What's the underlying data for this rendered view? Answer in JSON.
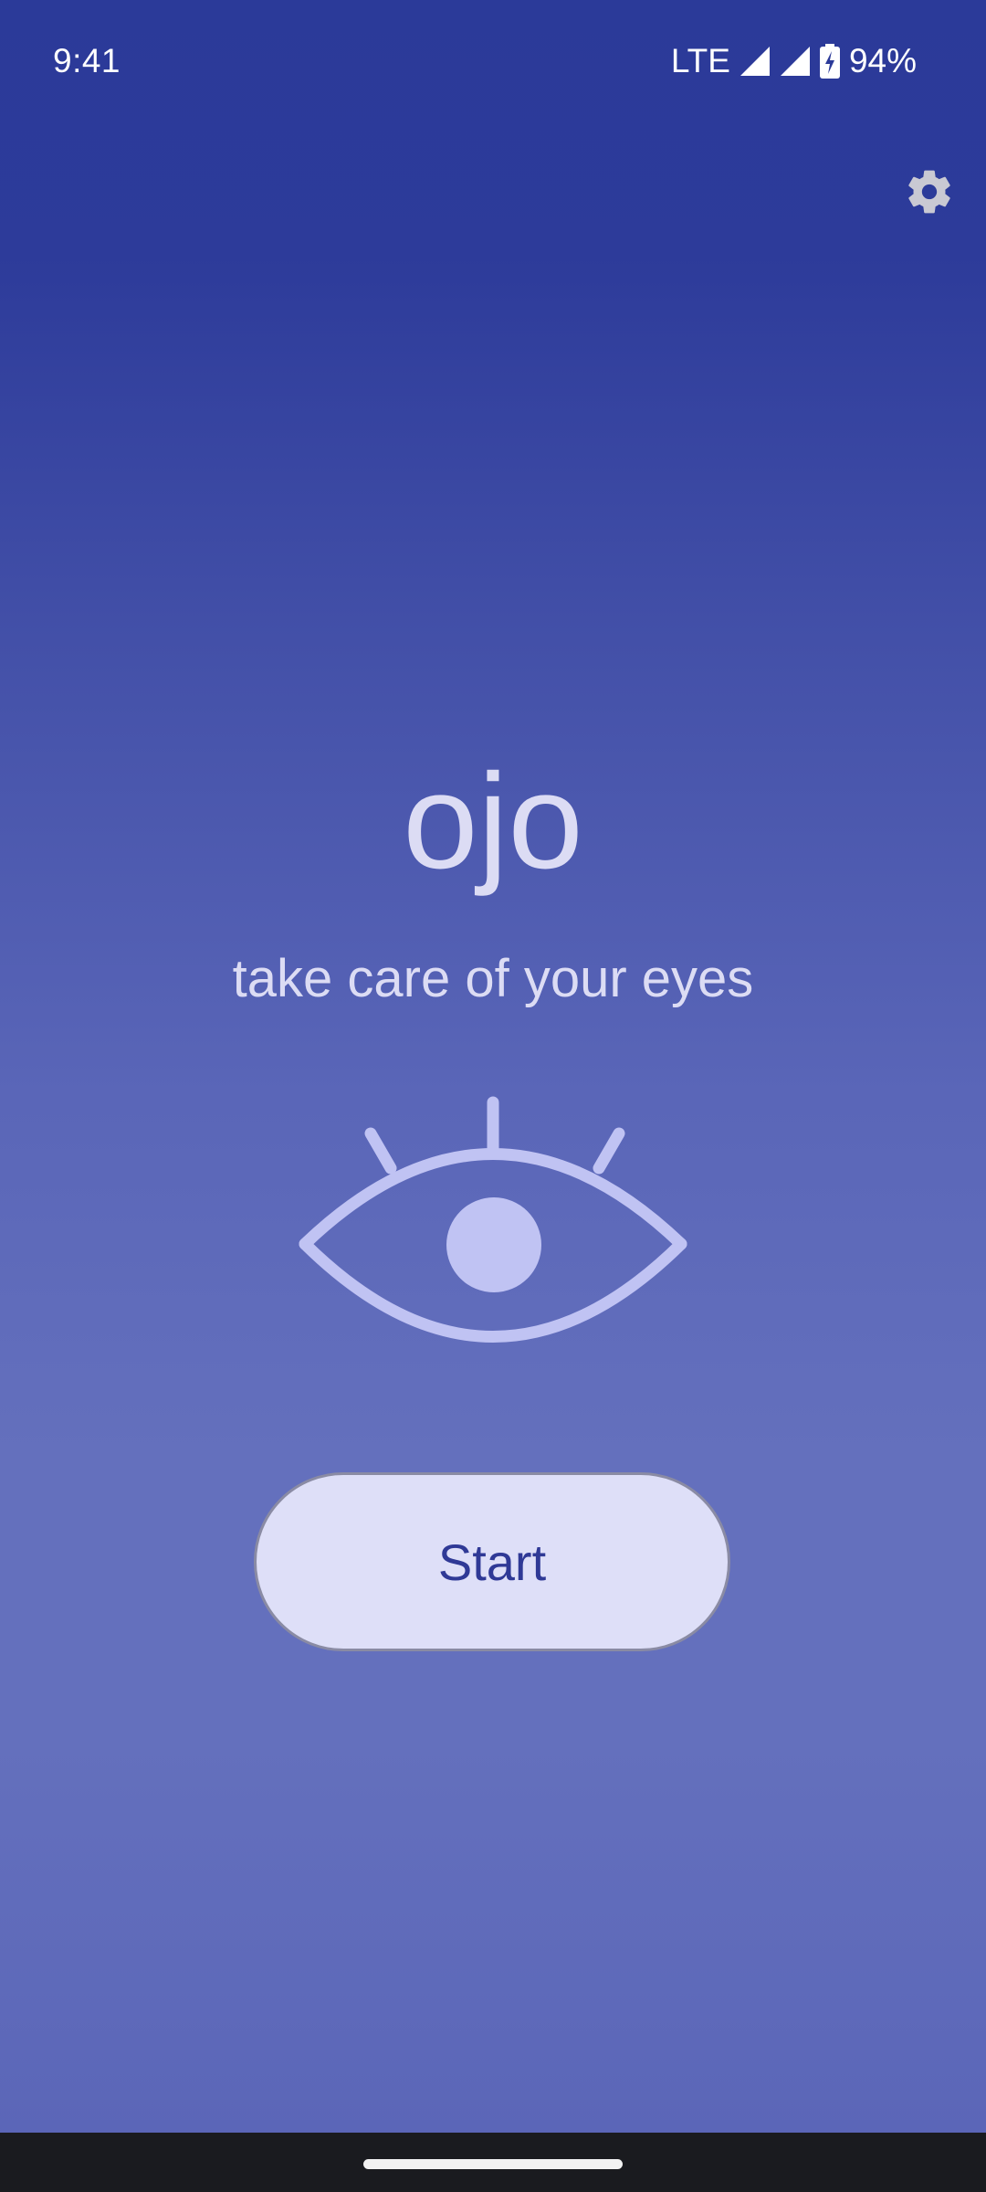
{
  "status_bar": {
    "time": "9:41",
    "network": "LTE",
    "battery": "94%",
    "icons": [
      "signal-icon",
      "signal-icon",
      "battery-charging-icon"
    ]
  },
  "header": {
    "settings_icon": "gear-icon"
  },
  "main": {
    "title": "ojo",
    "tagline": "take care of your eyes",
    "illustration_icon": "eye-icon",
    "start_label": "Start"
  },
  "colors": {
    "background_top": "#2b3a99",
    "background_mid": "#6470bd",
    "text": "#dcdcf4",
    "eye": "#c0c3f3",
    "button_fill": "#dedff8",
    "button_text": "#2f3996",
    "gear": "#c9c9d3",
    "nav_bar": "#1a1b1f"
  }
}
